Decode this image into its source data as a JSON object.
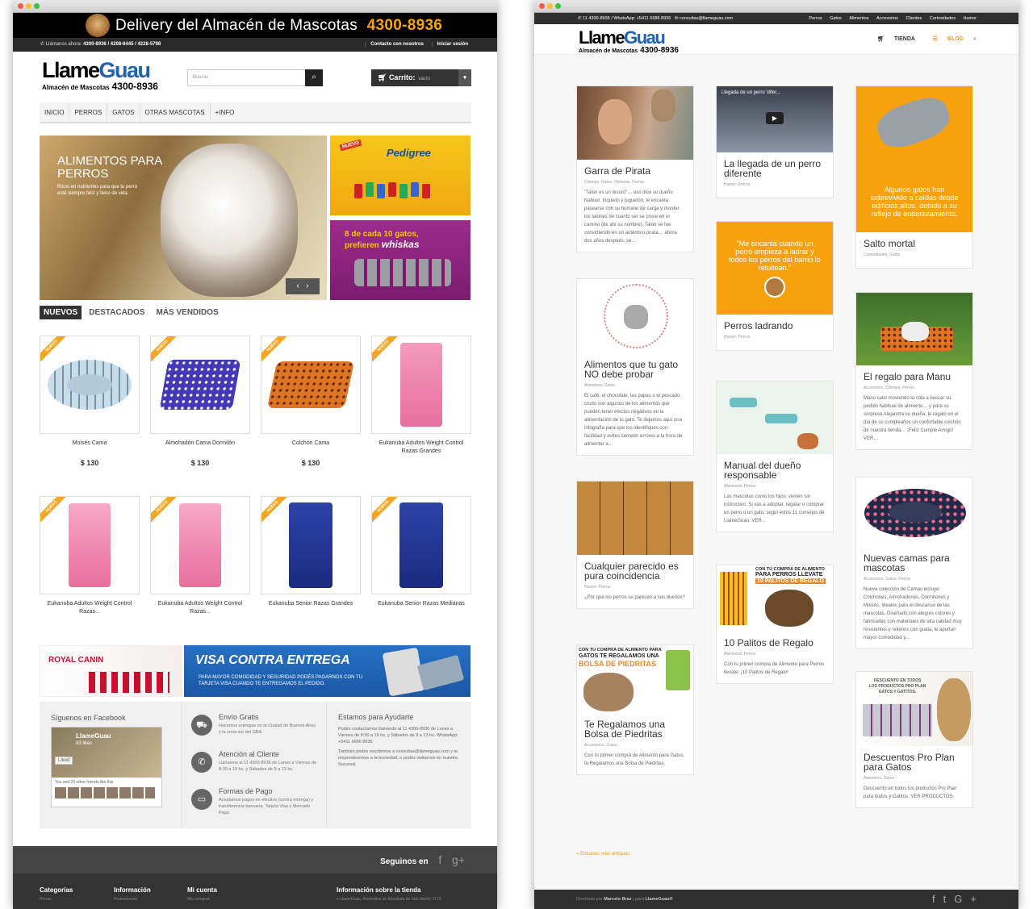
{
  "left": {
    "banner": {
      "text": "Delivery del Almacén de Mascotas",
      "phone": "4300-8936"
    },
    "topbar": {
      "prefix": "Llámanos ahora:",
      "phones": "4300-8936 / 4208-6445 / 4228-5798",
      "links": [
        "Contacto con nosotros",
        "Iniciar sesión"
      ]
    },
    "logo": {
      "part1": "Llame",
      "part2": "Guau",
      "sub": "Almacén de Mascotas",
      "phone": "4300-8936"
    },
    "search": {
      "placeholder": "Buscar"
    },
    "cart": {
      "label": "Carrito:",
      "status": "vacío"
    },
    "nav": [
      "INICIO",
      "PERROS",
      "GATOS",
      "OTRAS MASCOTAS",
      "+INFO"
    ],
    "hero": {
      "title": "ALIMENTOS PARA PERROS",
      "text": "Ricos en nutrientes para que tu perro esté siempre feliz y lleno de vida."
    },
    "promos": {
      "pedigree": "Pedigree",
      "nuevo": "NUEVO",
      "whiskas_text": "8 de cada 10 gatos, prefieren",
      "whiskas_brand": "whiskas"
    },
    "tabs": [
      "NUEVOS",
      "DESTACADOS",
      "MÁS VENDIDOS"
    ],
    "ribbon": "NUEVO",
    "products": [
      {
        "name": "Moisés Cama",
        "price": "$ 130"
      },
      {
        "name": "Almohadón Cama Dormilón",
        "price": "$ 130"
      },
      {
        "name": "Colchón Cama",
        "price": "$ 130"
      },
      {
        "name": "Eukanuba Adultos Weight Control Razas Grandes",
        "price": ""
      },
      {
        "name": "Eukanuba Adultos Weight Control Razas...",
        "price": ""
      },
      {
        "name": "Eukanuba Adultos Weight Control Razas...",
        "price": ""
      },
      {
        "name": "Eukanuba Senior Razas Grandes",
        "price": ""
      },
      {
        "name": "Eukanuba Senior Razas Medianas",
        "price": ""
      }
    ],
    "banners": {
      "royal": "ROYAL CANIN",
      "visa_title": "VISA CONTRA ENTREGA",
      "visa_sub": "PARA MAYOR COMODIDAD Y SEGURIDAD PODÉS PAGARNOS CON TU TARJETA VISA CUANDO TE ENTREGAMOS EL PEDIDO."
    },
    "facebook": {
      "title": "Síguenos en Facebook",
      "page": "LlameGuau",
      "likes": "83 likes",
      "liked": "Liked",
      "friends": "You and 22 other friends like this"
    },
    "services": [
      {
        "title": "Envío Gratis",
        "text": "Hacemos entregas en la Ciudad de Buenos Aires y la zona sur del GBA."
      },
      {
        "title": "Atención al Cliente",
        "text": "Llamanos al 11 4300-8936 de Lunes a Viernes de 8:30 a 19 hs, y Sábados de 9 a 13 hs."
      },
      {
        "title": "Formas de Pago",
        "text": "Aceptamos pagos en efectivo (contra entrega) y transferencia bancaria. Tarjeta Visa y Mercado Pago."
      }
    ],
    "help": {
      "title": "Estamos para Ayudarte",
      "text1": "Podés contactarnos llamando al 11 4300-8936 de Lunes a Viernes de 8:30 a 19 hs, y Sábados de 9 a 13 hs. WhatsApp: +5411 6686 8936",
      "text2": "También podés escribirnos a consultas@llameguau.com y te responderemos a la brevedad, o podés visitarnos en nuestra Sucursal."
    },
    "social": {
      "label": "Seguinos en",
      "icons": [
        "f",
        "g+"
      ]
    },
    "footer": [
      {
        "title": "Categorías",
        "item": "Perros"
      },
      {
        "title": "Información",
        "item": "Promociones"
      },
      {
        "title": "Mi cuenta",
        "item": "Mis compras"
      },
      {
        "title": "Información sobre la tienda",
        "item": "LlameGuau, Remedios de Escalada de San Martín 2173"
      }
    ]
  },
  "right": {
    "topbar": {
      "phone": "11 4300-8936 / WhatsApp: +5411 6686 8936",
      "email": "consultas@llameguau.com",
      "links": [
        "Perros",
        "Gatos",
        "Alimentos",
        "Accesorios",
        "Clientes",
        "Curiosidades",
        "Humor"
      ]
    },
    "nav": {
      "shop": "TIENDA",
      "blog": "BLOG"
    },
    "video_title": "Llegada de un perro 'difer...",
    "cards": [
      {
        "title": "Garra de Pirata",
        "meta": "Clientes, Gatos, Historias, Humor",
        "excerpt": "\"Talon es un tesoro\"… eso dice su dueño Nahuel. Inquieto y juguetón, le encanta pasearse con su humano de carga y morder los talones de cuanto ser se cruce en el camino (de ahí su nombre). Talon se fue convirtiendo en un auténtico pirata… ahora dos años después, se…"
      },
      {
        "title": "Alimentos que tu gato NO debe probar",
        "meta": "Alimentos, Gatos",
        "excerpt": "El café, el chocolate, las papas o el pescado crudo son algunos de los alimentos que pueden tener efectos negativos en la alimentación de tu gato. Te dejamos aquí una infografía para que los identifiques con facilidad y evites cometer errores a la hora de alimentar a…"
      },
      {
        "title": "Cualquier parecido es pura coincidencia",
        "meta": "Humor, Perros",
        "excerpt": "¿Por qué los perros se parecen a sus dueños?"
      },
      {
        "title": "Te Regalamos una Bolsa de Piedritas",
        "meta": "Accesorios, Gatos",
        "excerpt": "Con tu primer compra de Alimento para Gatos, te Regalamos una Bolsa de Piedritas."
      },
      {
        "title": "La llegada de un perro diferente",
        "meta": "Humor, Perros",
        "excerpt": ""
      },
      {
        "title": "Perros ladrando",
        "meta": "Humor, Perros",
        "excerpt": "",
        "quote": "\"Me encanta cuando un perro empieza a ladrar y todos los perros del barrio lo retuitean.\""
      },
      {
        "title": "Manual del dueño responsable",
        "meta": "Alimentos, Perros",
        "excerpt": "Las mascotas como los hijos: vienen sin instructivo. Si vas a adoptar, regalar o comprar un perro o un gato, seguí estos 11 consejos de LlameGuau. VER…"
      },
      {
        "title": "10 Palitos de Regalo",
        "meta": "Alimentos, Perros",
        "excerpt": "Con tu primer compra de Alimento para Perros llevate: ¡10 Palitos de Regalo!"
      },
      {
        "title": "Salto mortal",
        "meta": "Curiosidades, Gatos",
        "excerpt": "",
        "quote": "Algunos gatos han sobrevivido a caídas desde edificios altos, debido a su reflejo de enderezamiento."
      },
      {
        "title": "El regalo para Manu",
        "meta": "Accesorios, Clientes, Perros",
        "excerpt": "Manu salió moviendo la cola a buscar su pedido habitual de alimento… y para su sorpresa Alejandra su dueña, le regaló en el día de su cumpleaños un confortable colchón de nuestra tienda… ¡Feliz Cumple Amigo! VER…"
      },
      {
        "title": "Nuevas camas para mascotas",
        "meta": "Accesorios, Gatos, Perros",
        "excerpt": "Nueva colección de Camas incluye: Colchones, Almohadones, Dormilones y Moisés. Ideales para el descanso de las mascotas. Diseñado con alegres colores y fabricadas con materiales de alta calidad muy resistentes y rellenos con guata, le aportan mayor comodidad y…"
      },
      {
        "title": "Descuentos Pro Plan para Gatos",
        "meta": "Alimentos, Gatos",
        "excerpt": "Descuento en todos los productos Pro Plan para Gatos y Gatitos. VER PRODUCTOS"
      }
    ],
    "promo_text": {
      "palitos_1": "CON TU COMPRA DE ALIMENTO",
      "palitos_2": "PARA PERROS LLEVATE",
      "palitos_3": "10 PALITOS DE REGALO",
      "piedritas_1": "CON TU COMPRA DE ALIMENTO PARA",
      "piedritas_2": "GATOS TE REGALAMOS UNA",
      "piedritas_3": "BOLSA DE PIEDRITAS",
      "proplan_1": "DESCUENTO EN TODOS",
      "proplan_2": "LOS PRODUCTOS PRO PLAN",
      "proplan_3": "GATOS Y GATITOS."
    },
    "older": "« Entradas más antiguas",
    "footer": {
      "designed": "Diseñado por",
      "designer": "Marcelo Braz",
      "para": "para",
      "site": "LlameGuau®"
    }
  }
}
